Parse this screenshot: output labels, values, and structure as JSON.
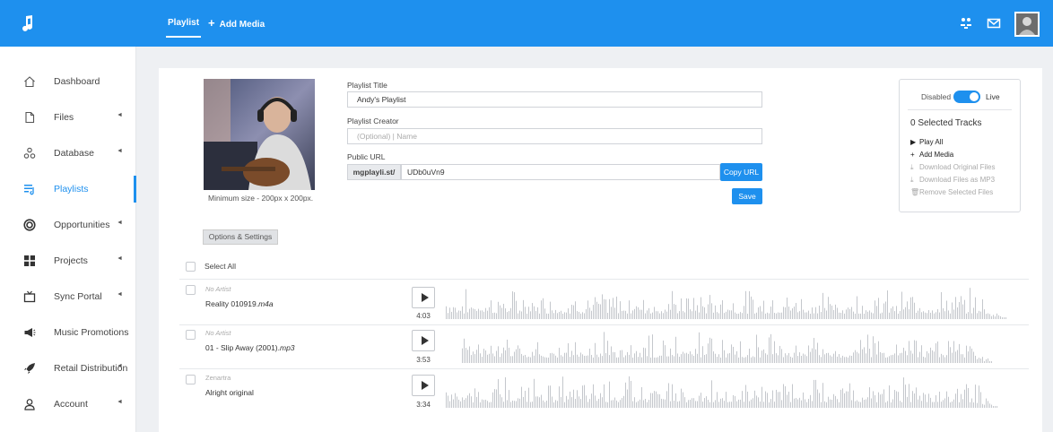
{
  "nav": {
    "tabs": [
      {
        "label": "Playlist"
      },
      {
        "label": "Add Media",
        "prefix": "+"
      }
    ]
  },
  "sidebar": {
    "items": [
      {
        "label": "Dashboard",
        "icon": "home-icon",
        "arrow": ""
      },
      {
        "label": "Files",
        "icon": "file-icon",
        "arrow": "◄"
      },
      {
        "label": "Database",
        "icon": "database-icon",
        "arrow": "◄"
      },
      {
        "label": "Playlists",
        "icon": "playlist-icon",
        "arrow": ""
      },
      {
        "label": "Opportunities",
        "icon": "target-icon",
        "arrow": "◄"
      },
      {
        "label": "Projects",
        "icon": "grid-icon",
        "arrow": "◄"
      },
      {
        "label": "Sync Portal",
        "icon": "tv-icon",
        "arrow": "◄"
      },
      {
        "label": "Music Promotions",
        "icon": "megaphone-icon",
        "arrow": ""
      },
      {
        "label": "Retail Distribution",
        "icon": "rocket-icon",
        "arrow": "◄"
      },
      {
        "label": "Account",
        "icon": "user-icon",
        "arrow": "◄"
      }
    ]
  },
  "playlist": {
    "cover_hint": "Minimum size - 200px x 200px.",
    "title_label": "Playlist Title",
    "title_value": "Andy's Playlist",
    "creator_label": "Playlist Creator",
    "creator_placeholder": "(Optional) | Name",
    "url_label": "Public URL",
    "url_prefix": "mgplayli.st/",
    "url_value": "UDb0uVn9",
    "copy_label": "Copy URL",
    "save_label": "Save",
    "options_label": "Options & Settings",
    "select_all": "Select All"
  },
  "panel": {
    "disabled": "Disabled",
    "live": "Live",
    "selected": "0 Selected Tracks",
    "actions": [
      {
        "icon": "▶",
        "label": "Play All",
        "enabled": true
      },
      {
        "icon": "+",
        "label": "Add Media",
        "enabled": true
      },
      {
        "icon": "⤓",
        "label": "Download Original Files",
        "enabled": false
      },
      {
        "icon": "⤓",
        "label": "Download Files as MP3",
        "enabled": false
      },
      {
        "icon": "🗑",
        "label": "Remove Selected Files",
        "enabled": false
      }
    ]
  },
  "tracks": [
    {
      "artist": "No Artist",
      "name": "Reality 010919.",
      "ext": "m4a",
      "duration": "4:03"
    },
    {
      "artist": "No Artist",
      "name": "01 - Slip Away (2001).",
      "ext": "mp3",
      "duration": "3:53"
    },
    {
      "artist": "Zenartra",
      "name": "Alright original",
      "ext": "",
      "duration": "3:34"
    }
  ],
  "colors": {
    "accent": "#1e90ee",
    "wave": "#c4c7cc",
    "background": "#eef0f3"
  }
}
